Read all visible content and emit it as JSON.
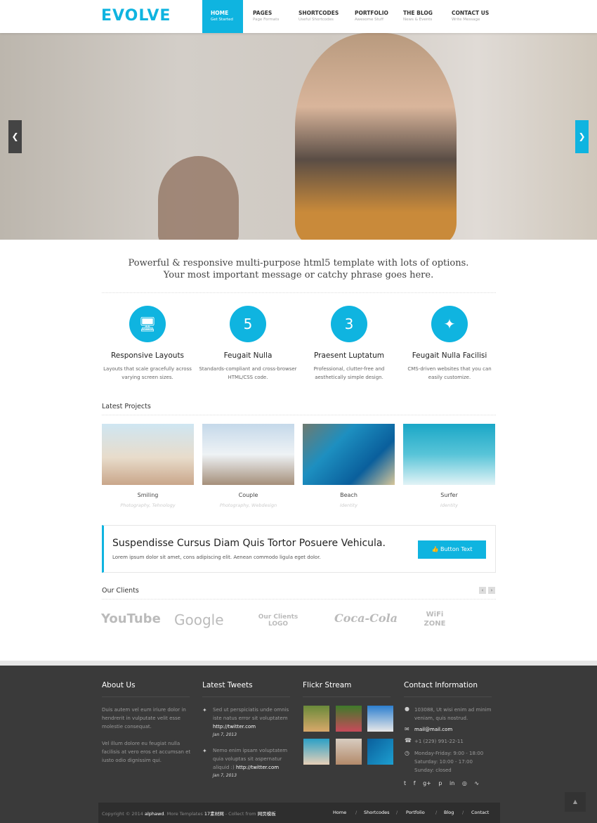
{
  "brand": {
    "logo": "EVOLVE",
    "accent": "#0fb4e0"
  },
  "nav": [
    {
      "label": "HOME",
      "sub": "Get Started",
      "active": true
    },
    {
      "label": "PAGES",
      "sub": "Page Formats"
    },
    {
      "label": "SHORTCODES",
      "sub": "Useful Shortcodes"
    },
    {
      "label": "PORTFOLIO",
      "sub": "Awesome Stuff"
    },
    {
      "label": "THE BLOG",
      "sub": "News & Events"
    },
    {
      "label": "CONTACT US",
      "sub": "Write Message"
    }
  ],
  "hero": {
    "prev_icon": "chevron-left-icon",
    "next_icon": "chevron-right-icon"
  },
  "tagline": {
    "line1": "Powerful & responsive multi-purpose html5 template with lots of options.",
    "line2": "Your most important message or catchy phrase goes here."
  },
  "features": [
    {
      "icon": "monitor-icon",
      "glyph": "🖥",
      "title": "Responsive Layouts",
      "text": "Layouts that scale gracefully across varying screen sizes."
    },
    {
      "icon": "html5-icon",
      "glyph": "5",
      "title": "Feugait Nulla",
      "text": "Standards-compliant and cross-browser HTML/CSS code."
    },
    {
      "icon": "css3-icon",
      "glyph": "3",
      "title": "Praesent Luptatum",
      "text": "Professional, clutter-free and aesthetically simple design."
    },
    {
      "icon": "magic-wand-icon",
      "glyph": "✦",
      "title": "Feugait Nulla Facilisi",
      "text": "CMS-driven websites that you can easily customize."
    }
  ],
  "projects": {
    "title": "Latest Projects",
    "items": [
      {
        "name": "Smiling",
        "tags": "Photography, Tehnology"
      },
      {
        "name": "Couple",
        "tags": "Photography, Webdesign"
      },
      {
        "name": "Beach",
        "tags": "Identity"
      },
      {
        "name": "Surfer",
        "tags": "Identity"
      }
    ]
  },
  "callout": {
    "title": "Suspendisse Cursus Diam Quis Tortor Posuere Vehicula.",
    "text": "Lorem ipsum dolor sit amet, cons adipiscing elit. Aenean commodo ligula eget dolor.",
    "button": "Button Text"
  },
  "clients": {
    "title": "Our Clients",
    "logos": [
      "YouTube",
      "Google",
      "Our Clients LOGO",
      "Coca-Cola",
      "WiFi ZONE"
    ]
  },
  "footer": {
    "about": {
      "title": "About Us",
      "p1": "Duis autem vel eum iriure dolor in hendrerit in vulputate velit esse molestie consequat.",
      "p2": "Vel illum dolore eu feugiat nulla facilisis at vero eros et accumsan et iusto odio dignissim qui."
    },
    "tweets": {
      "title": "Latest Tweets",
      "items": [
        {
          "text": "Sed ut perspiciatis unde omnis iste natus error sit voluptatem",
          "link": "http://twitter.com",
          "date": "Jan 7, 2013"
        },
        {
          "text": "Nemo enim ipsam voluptatem quia voluptas sit aspernatur aliquid :)",
          "link": "http://twitter.com",
          "date": "Jan 7, 2013"
        }
      ]
    },
    "flickr": {
      "title": "Flickr Stream"
    },
    "contact": {
      "title": "Contact Information",
      "address": "103088, Ut wisi enim ad minim veniam, quis nostrud.",
      "email": "mail@mail.com",
      "phone": "+1 (229) 991-22-11",
      "hours1": "Monday-Friday: 9:00 - 18:00",
      "hours2": "Saturday: 10:00 - 17:00",
      "hours3": "Sunday: closed"
    },
    "social": [
      "twitter-icon",
      "facebook-icon",
      "google-plus-icon",
      "pinterest-icon",
      "linkedin-icon",
      "dribbble-icon",
      "rss-icon"
    ],
    "copyright": {
      "pre": "Copyright © 2014 ",
      "author": "alphawd",
      "mid": ". More Templates ",
      "site": "17素材网",
      "mid2": " - Collect from ",
      "site2": "网页模板"
    },
    "links": [
      "Home",
      "Shortcodes",
      "Portfolio",
      "Blog",
      "Contact"
    ]
  }
}
